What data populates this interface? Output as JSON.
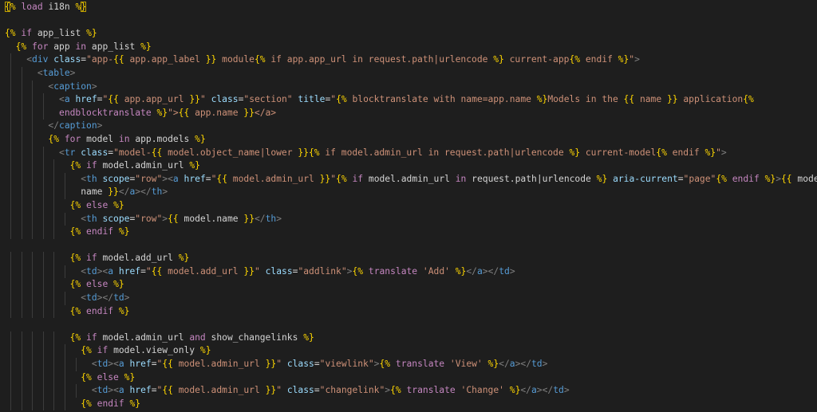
{
  "editor": {
    "language": "Django HTML template",
    "theme": "dark",
    "lines": [
      "{% load i18n %}",
      "",
      "{% if app_list %}",
      "  {% for app in app_list %}",
      "    <div class=\"app-{{ app.app_label }} module{% if app.app_url in request.path|urlencode %} current-app{% endif %}\">",
      "      <table>",
      "        <caption>",
      "          <a href=\"{{ app.app_url }}\" class=\"section\" title=\"{% blocktranslate with name=app.name %}Models in the {{ name }} application{%",
      "          endblocktranslate %}\">{{ app.name }}</a>",
      "        </caption>",
      "        {% for model in app.models %}",
      "          <tr class=\"model-{{ model.object_name|lower }}{% if model.admin_url in request.path|urlencode %} current-model{% endif %}\">",
      "            {% if model.admin_url %}",
      "              <th scope=\"row\"><a href=\"{{ model.admin_url }}\"{% if model.admin_url in request.path|urlencode %} aria-current=\"page\"{% endif %}>{{ model.",
      "              name }}</a></th>",
      "            {% else %}",
      "              <th scope=\"row\">{{ model.name }}</th>",
      "            {% endif %}",
      "",
      "            {% if model.add_url %}",
      "              <td><a href=\"{{ model.add_url }}\" class=\"addlink\">{% translate 'Add' %}</a></td>",
      "            {% else %}",
      "              <td></td>",
      "            {% endif %}",
      "",
      "            {% if model.admin_url and show_changelinks %}",
      "              {% if model.view_only %}",
      "                <td><a href=\"{{ model.admin_url }}\" class=\"viewlink\">{% translate 'View' %}</a></td>",
      "              {% else %}",
      "                <td><a href=\"{{ model.admin_url }}\" class=\"changelink\">{% translate 'Change' %}</a></td>",
      "              {% endif %}"
    ]
  }
}
